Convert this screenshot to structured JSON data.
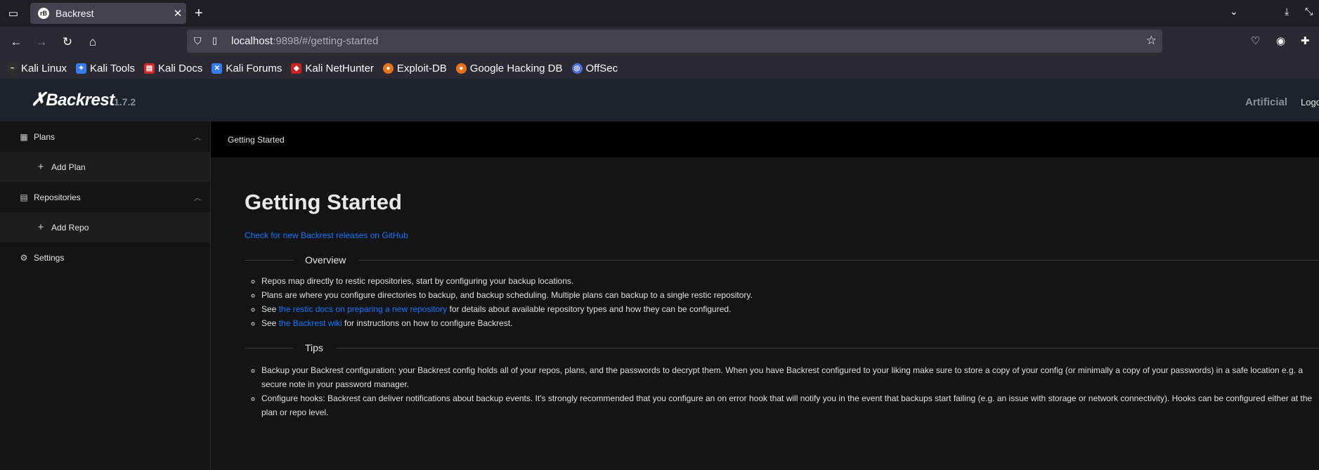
{
  "browser": {
    "tab_title": "Backrest",
    "favicon_text": "rB",
    "url_host": "localhost",
    "url_rest": ":9898/#/getting-started",
    "bookmarks": [
      {
        "label": "Kali Linux",
        "icon": "kali-dragon-icon",
        "color": "#2f2f2f"
      },
      {
        "label": "Kali Tools",
        "icon": "kali-tools-icon",
        "color": "#367bf0"
      },
      {
        "label": "Kali Docs",
        "icon": "kali-docs-icon",
        "color": "#d12a2a"
      },
      {
        "label": "Kali Forums",
        "icon": "kali-forums-icon",
        "color": "#367bf0"
      },
      {
        "label": "Kali NetHunter",
        "icon": "kali-nethunter-icon",
        "color": "#c22"
      },
      {
        "label": "Exploit-DB",
        "icon": "exploit-db-icon",
        "color": "#e8731c"
      },
      {
        "label": "Google Hacking DB",
        "icon": "ghdb-icon",
        "color": "#e8731c"
      },
      {
        "label": "OffSec",
        "icon": "offsec-icon",
        "color": "#4a6ee0"
      }
    ]
  },
  "header": {
    "logo": "Backrest",
    "version": "1.7.2",
    "instance": "Artificial",
    "logout": "Logout"
  },
  "sidebar": {
    "plans": "Plans",
    "add_plan": "Add Plan",
    "repositories": "Repositories",
    "add_repo": "Add Repo",
    "settings": "Settings"
  },
  "main": {
    "breadcrumb": "Getting Started",
    "title": "Getting Started",
    "releases_link": "Check for new Backrest releases on GitHub",
    "overview_heading": "Overview",
    "overview": {
      "item1": "Repos map directly to restic repositories, start by configuring your backup locations.",
      "item2": "Plans are where you configure directories to backup, and backup scheduling. Multiple plans can backup to a single restic repository.",
      "item3_prefix": "See ",
      "item3_link": "the restic docs on preparing a new repository",
      "item3_suffix": " for details about available repository types and how they can be configured.",
      "item4_prefix": "See ",
      "item4_link": "the Backrest wiki",
      "item4_suffix": " for instructions on how to configure Backrest."
    },
    "tips_heading": "Tips",
    "tips": {
      "item1": "Backup your Backrest configuration: your Backrest config holds all of your repos, plans, and the passwords to decrypt them. When you have Backrest configured to your liking make sure to store a copy of your config (or minimally a copy of your passwords) in a safe location e.g. a secure note in your password manager.",
      "item2": "Configure hooks: Backrest can deliver notifications about backup events. It's strongly recommended that you configure an on error hook that will notify you in the event that backups start failing (e.g. an issue with storage or network connectivity). Hooks can be configured either at the plan or repo level."
    }
  }
}
